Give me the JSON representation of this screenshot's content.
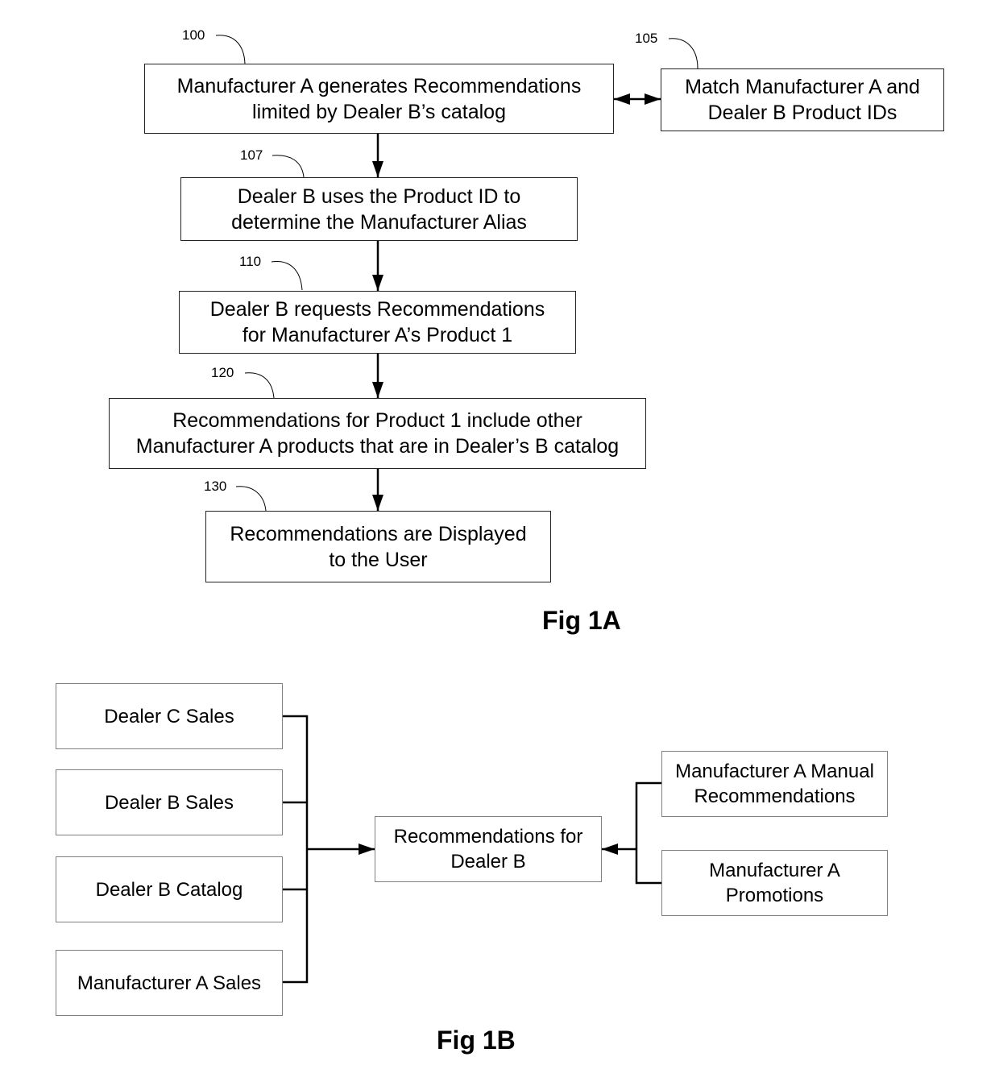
{
  "fig1a": {
    "caption": "Fig 1A",
    "steps": [
      {
        "ref": "100",
        "lines": [
          "Manufacturer A generates Recommendations",
          "limited by Dealer B’s catalog"
        ]
      },
      {
        "ref": "105",
        "lines": [
          "Match Manufacturer A and",
          "Dealer B Product IDs"
        ]
      },
      {
        "ref": "107",
        "lines": [
          "Dealer B uses the Product ID to",
          "determine the Manufacturer Alias"
        ]
      },
      {
        "ref": "110",
        "lines": [
          "Dealer B requests Recommendations",
          "for Manufacturer A’s Product 1"
        ]
      },
      {
        "ref": "120",
        "lines": [
          "Recommendations for Product 1 include other",
          "Manufacturer A products that are in Dealer’s B catalog"
        ]
      },
      {
        "ref": "130",
        "lines": [
          "Recommendations are Displayed",
          "to the User"
        ]
      }
    ]
  },
  "fig1b": {
    "caption": "Fig 1B",
    "inputs_left": [
      {
        "lines": [
          "Dealer C Sales"
        ]
      },
      {
        "lines": [
          "Dealer B Sales"
        ]
      },
      {
        "lines": [
          "Dealer B Catalog"
        ]
      },
      {
        "lines": [
          "Manufacturer A Sales"
        ]
      }
    ],
    "center": {
      "lines": [
        "Recommendations for",
        "Dealer B"
      ]
    },
    "inputs_right": [
      {
        "lines": [
          "Manufacturer A Manual",
          "Recommendations"
        ]
      },
      {
        "lines": [
          "Manufacturer A",
          "Promotions"
        ]
      }
    ]
  }
}
